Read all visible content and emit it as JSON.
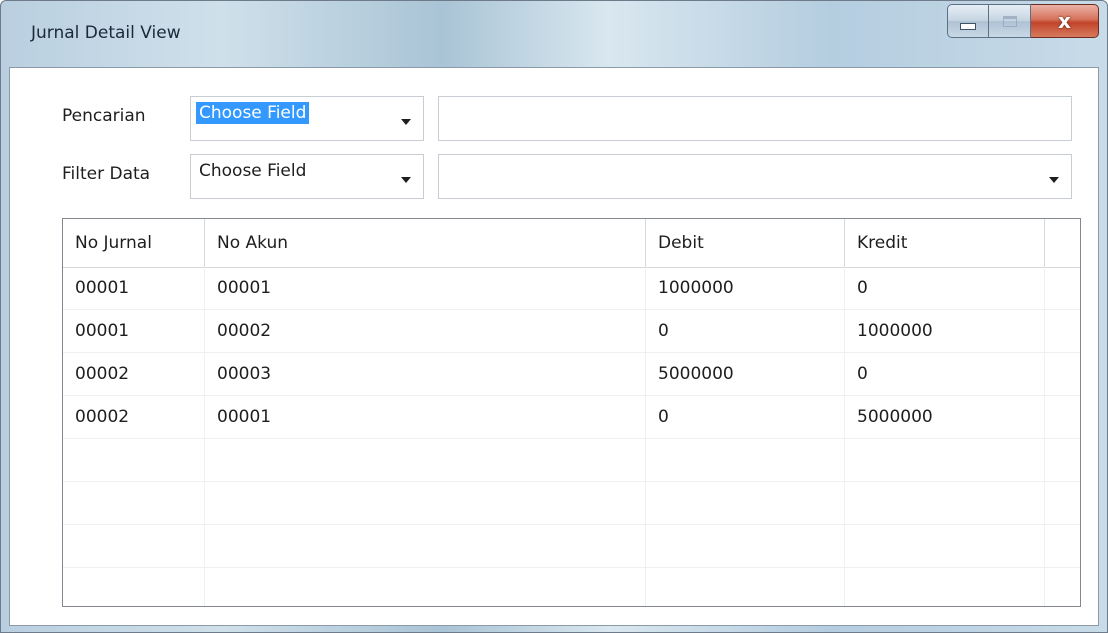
{
  "window": {
    "title": "Jurnal Detail View",
    "caption": {
      "minimize_icon": "minimize-icon",
      "maximize_icon": "maximize-icon",
      "close_glyph": "x"
    }
  },
  "search": {
    "label": "Pencarian",
    "field_value": "Choose Field",
    "text_value": ""
  },
  "filter": {
    "label": "Filter Data",
    "field_value": "Choose Field",
    "value": ""
  },
  "grid": {
    "columns": [
      "No Jurnal",
      "No Akun",
      "Debit",
      "Kredit"
    ],
    "rows": [
      [
        "00001",
        "00001",
        "1000000",
        "0"
      ],
      [
        "00001",
        "00002",
        "0",
        "1000000"
      ],
      [
        "00002",
        "00003",
        "5000000",
        "0"
      ],
      [
        "00002",
        "00001",
        "0",
        "5000000"
      ]
    ]
  },
  "colors": {
    "selection": "#3399ff",
    "close_button": "#c2442a",
    "grid_border": "#828790"
  }
}
